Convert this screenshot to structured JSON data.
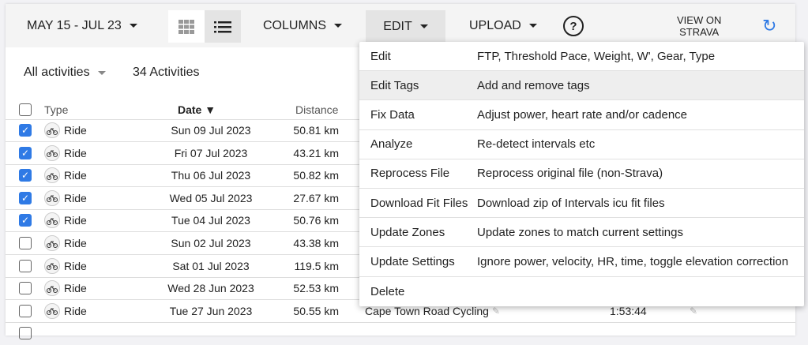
{
  "toolbar": {
    "date_range": "MAY 15 - JUL 23",
    "columns": "COLUMNS",
    "edit": "EDIT",
    "upload": "UPLOAD",
    "help": "?",
    "view_on_strava_1": "VIEW ON",
    "view_on_strava_2": "STRAVA"
  },
  "filter": {
    "selected": "All activities",
    "count": "34 Activities"
  },
  "table": {
    "headers": {
      "type": "Type",
      "date": "Date ▼",
      "distance": "Distance"
    },
    "rows": [
      {
        "checked": true,
        "type": "Ride",
        "date": "Sun 09 Jul 2023",
        "distance": "50.81 km"
      },
      {
        "checked": true,
        "type": "Ride",
        "date": "Fri 07 Jul 2023",
        "distance": "43.21 km"
      },
      {
        "checked": true,
        "type": "Ride",
        "date": "Thu 06 Jul 2023",
        "distance": "50.82 km"
      },
      {
        "checked": true,
        "type": "Ride",
        "date": "Wed 05 Jul 2023",
        "distance": "27.67 km"
      },
      {
        "checked": true,
        "type": "Ride",
        "date": "Tue 04 Jul 2023",
        "distance": "50.76 km"
      },
      {
        "checked": false,
        "type": "Ride",
        "date": "Sun 02 Jul 2023",
        "distance": "43.38 km"
      },
      {
        "checked": false,
        "type": "Ride",
        "date": "Sat 01 Jul 2023",
        "distance": "119.5 km"
      },
      {
        "checked": false,
        "type": "Ride",
        "date": "Wed 28 Jun 2023",
        "distance": "52.53 km"
      },
      {
        "checked": false,
        "type": "Ride",
        "date": "Tue 27 Jun 2023",
        "distance": "50.55 km",
        "name": "Cape Town Road Cycling",
        "time": "1:53:44"
      }
    ]
  },
  "menu": [
    {
      "label": "Edit",
      "desc": "FTP, Threshold Pace, Weight, W', Gear, Type"
    },
    {
      "label": "Edit Tags",
      "desc": "Add and remove tags",
      "highlighted": true
    },
    {
      "label": "Fix Data",
      "desc": "Adjust power, heart rate and/or cadence"
    },
    {
      "label": "Analyze",
      "desc": "Re-detect intervals etc"
    },
    {
      "label": "Reprocess File",
      "desc": "Reprocess original file (non-Strava)"
    },
    {
      "label": "Download Fit Files",
      "desc": "Download zip of Intervals icu fit files"
    },
    {
      "label": "Update Zones",
      "desc": "Update zones to match current settings"
    },
    {
      "label": "Update Settings",
      "desc": "Ignore power, velocity, HR, time, toggle elevation correction"
    },
    {
      "label": "Delete",
      "desc": ""
    }
  ],
  "colors": {
    "accent": "#2f7ae5"
  }
}
